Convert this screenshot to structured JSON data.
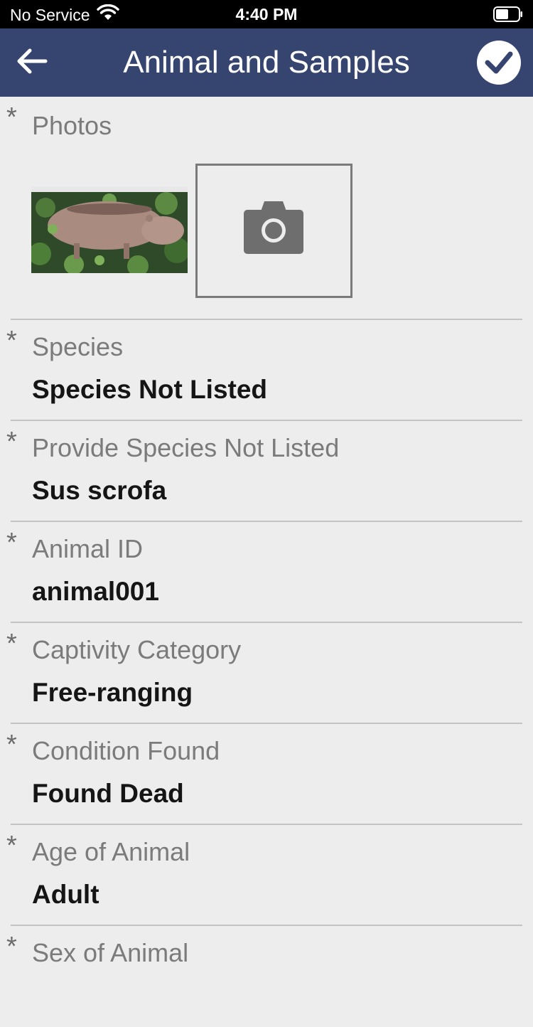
{
  "status_bar": {
    "carrier": "No Service",
    "time": "4:40 PM",
    "wifi_icon": "wifi-icon",
    "battery_icon": "battery-icon"
  },
  "header": {
    "title": "Animal and Samples",
    "back_icon": "arrow-left-icon",
    "save_icon": "check-circle-icon",
    "background": "#364470"
  },
  "photos": {
    "required_marker": "*",
    "label": "Photos",
    "add_icon": "camera-icon"
  },
  "fields": [
    {
      "required_marker": "*",
      "label": "Species",
      "value": "Species Not Listed"
    },
    {
      "required_marker": "*",
      "label": "Provide Species Not Listed",
      "value": "Sus scrofa"
    },
    {
      "required_marker": "*",
      "label": "Animal ID",
      "value": "animal001"
    },
    {
      "required_marker": "*",
      "label": "Captivity Category",
      "value": "Free-ranging"
    },
    {
      "required_marker": "*",
      "label": "Condition Found",
      "value": "Found Dead"
    },
    {
      "required_marker": "*",
      "label": "Age of Animal",
      "value": "Adult"
    },
    {
      "required_marker": "*",
      "label": "Sex of Animal",
      "value": ""
    }
  ],
  "colors": {
    "background": "#ededed",
    "label": "#7b7b7b",
    "value": "#151515",
    "divider": "#c4c4c4"
  }
}
